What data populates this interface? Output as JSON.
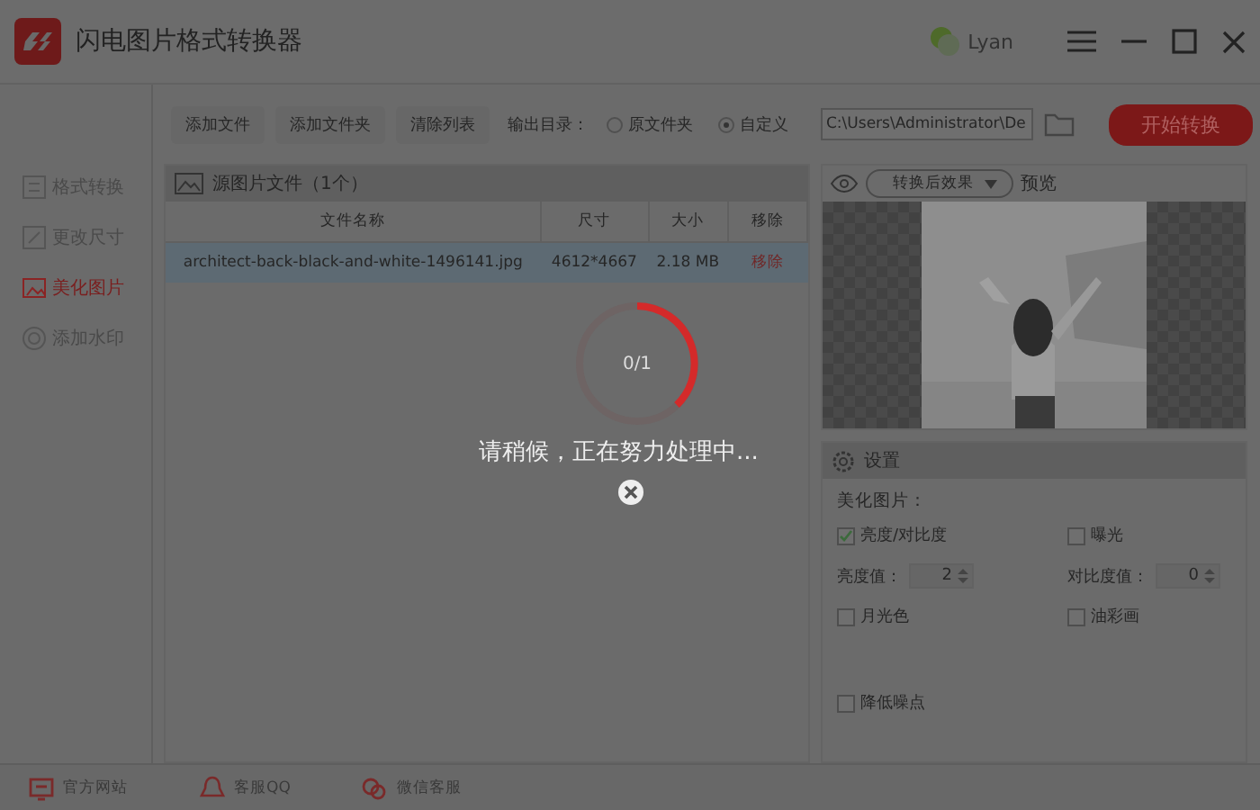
{
  "window": {
    "title": "闪电图片格式转换器"
  },
  "user": {
    "name": "Lyan"
  },
  "toolbar": {
    "buttons": [
      "添加文件",
      "添加文件夹",
      "清除列表"
    ],
    "output_label": "输出目录：",
    "radios": [
      {
        "label": "原文件夹",
        "selected": false
      },
      {
        "label": "自定义",
        "selected": true
      }
    ],
    "path": {
      "value": "C:\\Users\\Administrator\\De"
    },
    "start_button": "开始转换"
  },
  "sidebar": {
    "items": [
      {
        "label": "格式转换",
        "selected": false
      },
      {
        "label": "更改尺寸",
        "selected": false
      },
      {
        "label": "美化图片",
        "selected": true
      },
      {
        "label": "添加水印",
        "selected": false
      }
    ]
  },
  "file_panel": {
    "title": "源图片文件（1个）",
    "columns": [
      "文件名称",
      "尺寸",
      "大小",
      "移除"
    ],
    "rows": [
      {
        "name": "architect-back-black-and-white-1496141.jpg",
        "size": "4612*4667",
        "filesize": "2.18 MB",
        "remove": "移除",
        "selected": true
      }
    ]
  },
  "progress": {
    "count": "0/1",
    "message": "请稍候，正在努力处理中..."
  },
  "preview": {
    "mode": "转换后效果",
    "label": "预览"
  },
  "settings": {
    "title": "设置",
    "section": "美化图片：",
    "options": [
      {
        "kind": "checkbox",
        "label": "亮度/对比度",
        "checked": true
      },
      {
        "kind": "checkbox",
        "label": "曝光",
        "checked": false
      },
      {
        "kind": "spinner",
        "label": "亮度值：",
        "value": "2"
      },
      {
        "kind": "spinner",
        "label": "对比度值：",
        "value": "0"
      },
      {
        "kind": "checkbox",
        "label": "月光色",
        "checked": false
      },
      {
        "kind": "checkbox",
        "label": "油彩画",
        "checked": false
      },
      {
        "kind": "checkbox",
        "label": "降低噪点",
        "checked": false
      }
    ]
  },
  "footer": {
    "links": [
      "官方网站",
      "客服QQ",
      "微信客服"
    ]
  }
}
